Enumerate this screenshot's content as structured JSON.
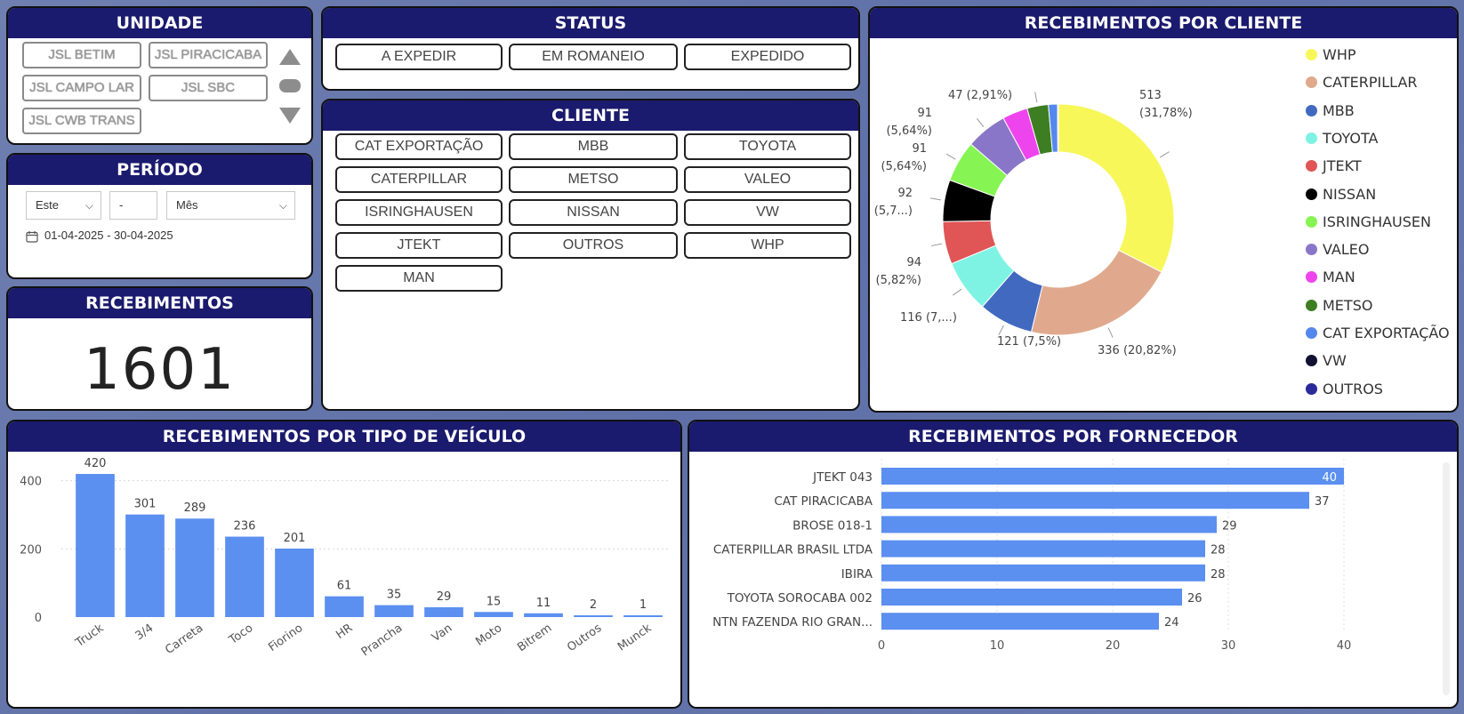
{
  "unidade": {
    "title": "UNIDADE",
    "items": [
      "JSL BETIM",
      "JSL PIRACICABA",
      "JSL CAMPO LARGO",
      "JSL SBC",
      "JSL CWB TRANS"
    ],
    "display": [
      "JSL BETIM",
      "JSL PIRACICABA",
      "JSL CAMPO LAR",
      "JSL SBC",
      "JSL CWB TRANS"
    ]
  },
  "status": {
    "title": "STATUS",
    "items": [
      "A EXPEDIR",
      "EM ROMANEIO",
      "EXPEDIDO"
    ]
  },
  "cliente": {
    "title": "CLIENTE",
    "items": [
      "CAT EXPORTAÇÃO",
      "MBB",
      "TOYOTA",
      "CATERPILLAR",
      "METSO",
      "VALEO",
      "ISRINGHAUSEN",
      "NISSAN",
      "VW",
      "JTEKT",
      "OUTROS",
      "WHP",
      "MAN"
    ]
  },
  "periodo": {
    "title": "PERÍODO",
    "relative": "Este",
    "count": "-",
    "unit": "Mês",
    "range": "01-04-2025 - 30-04-2025"
  },
  "recebimentos": {
    "title": "RECEBIMENTOS",
    "value": "1601"
  },
  "colors": {
    "header_bg": "#1a1a6e",
    "bar": "#5b8ff0"
  },
  "donut": {
    "title": "RECEBIMENTOS POR CLIENTE",
    "chart_data": {
      "type": "pie",
      "series": [
        {
          "name": "WHP",
          "value": 513,
          "color": "#f7f75a",
          "label": [
            "513",
            "(31,78%)"
          ]
        },
        {
          "name": "CATERPILLAR",
          "value": 336,
          "color": "#e0a98e",
          "label": [
            "336 (20,82%)"
          ]
        },
        {
          "name": "MBB",
          "value": 121,
          "color": "#4169c0",
          "label": [
            "121 (7,5%)"
          ]
        },
        {
          "name": "TOYOTA",
          "value": 116,
          "color": "#7ff3e3",
          "label": [
            "116 (7,...)"
          ]
        },
        {
          "name": "JTEKT",
          "value": 94,
          "color": "#e05555",
          "label": [
            "94",
            "(5,82%)"
          ]
        },
        {
          "name": "NISSAN",
          "value": 92,
          "color": "#000000",
          "label": [
            "92",
            "(5,7...)"
          ]
        },
        {
          "name": "ISRINGHAUSEN",
          "value": 91,
          "color": "#86f553",
          "label": [
            "91",
            "(5,64%)"
          ]
        },
        {
          "name": "VALEO",
          "value": 91,
          "color": "#8a76c8",
          "label": [
            "91",
            "(5,64%)"
          ]
        },
        {
          "name": "MAN",
          "value": 56,
          "color": "#ee44ee",
          "label": []
        },
        {
          "name": "METSO",
          "value": 47,
          "color": "#3e7e22",
          "label": [
            "47 (2,91%)"
          ]
        },
        {
          "name": "CAT EXPORTAÇÃO",
          "value": 20,
          "color": "#5588ee",
          "label": []
        },
        {
          "name": "VW",
          "value": 1,
          "color": "#111133",
          "label": []
        },
        {
          "name": "OUTROS",
          "value": 1,
          "color": "#2a2a9a",
          "label": []
        }
      ]
    }
  },
  "vehicle": {
    "title": "RECEBIMENTOS POR TIPO DE VEÍCULO",
    "chart_data": {
      "type": "bar",
      "categories": [
        "Truck",
        "3/4",
        "Carreta",
        "Toco",
        "Fiorino",
        "HR",
        "Prancha",
        "Van",
        "Moto",
        "Bitrem",
        "Outros",
        "Munck"
      ],
      "values": [
        420,
        301,
        289,
        236,
        201,
        61,
        35,
        29,
        15,
        11,
        2,
        1
      ],
      "yticks": [
        0,
        200,
        400
      ],
      "ylim": [
        0,
        450
      ]
    }
  },
  "supplier": {
    "title": "RECEBIMENTOS POR FORNECEDOR",
    "chart_data": {
      "type": "bar",
      "orientation": "horizontal",
      "categories": [
        "JTEKT 043",
        "CAT PIRACICABA",
        "BROSE 018-1",
        "CATERPILLAR BRASIL LTDA",
        "IBIRA",
        "TOYOTA SOROCABA 002",
        "NTN FAZENDA RIO GRAN..."
      ],
      "values": [
        40,
        37,
        29,
        28,
        28,
        26,
        24
      ],
      "xticks": [
        0,
        10,
        20,
        30,
        40
      ],
      "xlim": [
        0,
        40
      ]
    }
  }
}
